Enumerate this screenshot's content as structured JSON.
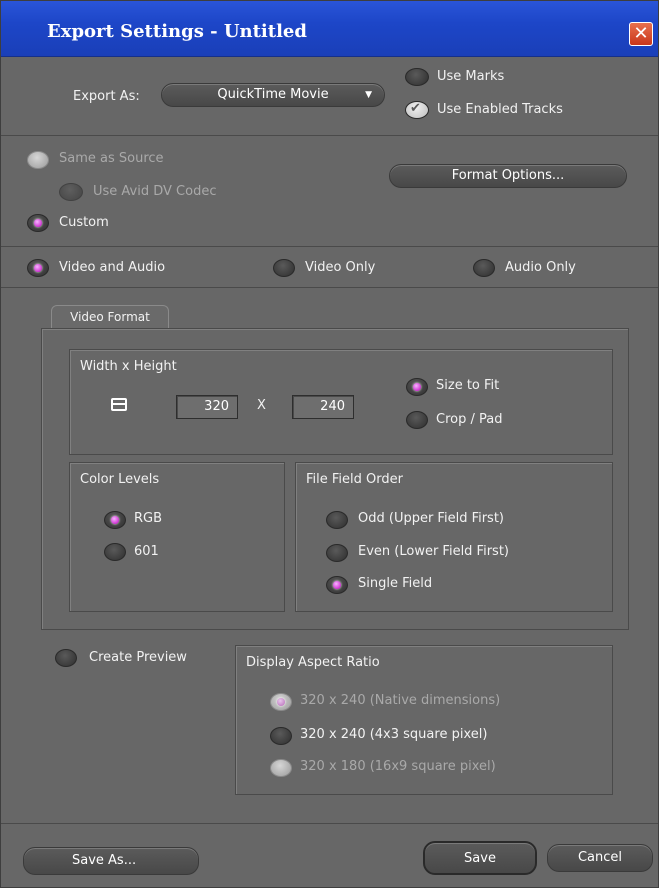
{
  "window": {
    "title": "Export Settings - Untitled",
    "close_glyph": "✕"
  },
  "export": {
    "label": "Export As:",
    "format_value": "QuickTime Movie",
    "use_marks_label": "Use Marks",
    "use_enabled_tracks_label": "Use Enabled Tracks",
    "use_marks_checked": false,
    "use_enabled_tracks_checked": true
  },
  "source": {
    "same_as_source_label": "Same as Source",
    "use_avid_dv_label": "Use Avid DV Codec",
    "custom_label": "Custom",
    "format_options_label": "Format Options..."
  },
  "content": {
    "video_and_audio_label": "Video and Audio",
    "video_only_label": "Video Only",
    "audio_only_label": "Audio Only"
  },
  "video_format": {
    "tab_label": "Video Format",
    "size_group_label": "Width x Height",
    "width": "320",
    "x_label": "X",
    "height": "240",
    "size_to_fit_label": "Size to Fit",
    "crop_pad_label": "Crop / Pad",
    "color_levels_label": "Color Levels",
    "rgb_label": "RGB",
    "601_label": "601",
    "field_order_label": "File Field Order",
    "odd_label": "Odd (Upper Field First)",
    "even_label": "Even (Lower Field First)",
    "single_label": "Single Field"
  },
  "preview": {
    "create_preview_label": "Create Preview",
    "aspect_ratio_label": "Display Aspect Ratio",
    "option1": "320 x 240  (Native dimensions)",
    "option2": "320 x 240  (4x3 square pixel)",
    "option3": "320 x 180  (16x9 square pixel)"
  },
  "buttons": {
    "save_as": "Save As...",
    "save": "Save",
    "cancel": "Cancel"
  },
  "colors": {
    "title_bar": "#1d46c8",
    "panel": "#676767",
    "radio_on": "#c000c0",
    "close": "#d2472a"
  }
}
